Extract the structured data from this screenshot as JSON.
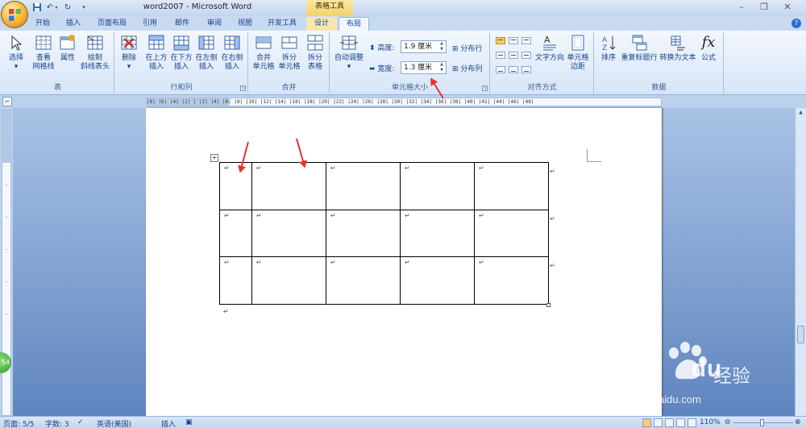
{
  "window": {
    "title": "word2007 - Microsoft Word",
    "context_tab_title": "表格工具",
    "controls": {
      "minimize": "–",
      "restore": "❐",
      "close": "✕"
    }
  },
  "tabs": [
    {
      "label": "开始"
    },
    {
      "label": "插入"
    },
    {
      "label": "页面布局"
    },
    {
      "label": "引用"
    },
    {
      "label": "邮件"
    },
    {
      "label": "审阅"
    },
    {
      "label": "视图"
    },
    {
      "label": "开发工具"
    },
    {
      "label": "设计"
    },
    {
      "label": "布局",
      "active": true
    }
  ],
  "ribbon": {
    "table": {
      "label": "表",
      "select": "选择",
      "gridlines_1": "查看",
      "gridlines_2": "网格线",
      "properties": "属性",
      "diag_1": "绘制",
      "diag_2": "斜线表头"
    },
    "rows_cols": {
      "label": "行和列",
      "delete": "删除",
      "above_1": "在上方",
      "above_2": "插入",
      "below_1": "在下方",
      "below_2": "插入",
      "left_1": "在左侧",
      "left_2": "插入",
      "right_1": "在右侧",
      "right_2": "插入"
    },
    "merge": {
      "label": "合并",
      "merge_1": "合并",
      "merge_2": "单元格",
      "split_1": "拆分",
      "split_2": "单元格",
      "splittable_1": "拆分",
      "splittable_2": "表格"
    },
    "cell_size": {
      "label": "单元格大小",
      "autofit": "自动调整",
      "height_label": "高度:",
      "height_value": "1.9 厘米",
      "width_label": "宽度:",
      "width_value": "1.3 厘米",
      "dist_rows": "分布行",
      "dist_cols": "分布列"
    },
    "alignment": {
      "label": "对齐方式",
      "text_dir": "文字方向",
      "margins_1": "单元格",
      "margins_2": "边距"
    },
    "data": {
      "label": "数据",
      "sort": "排序",
      "repeat_header": "重复标题行",
      "to_text": "转换为文本",
      "formula": "公式",
      "formula_glyph": "fx"
    }
  },
  "document": {
    "para_mark": "↵",
    "table_handle": "+",
    "ruler_top": "|8| |6| |4| |2| | |2| |4| |6| |8| |10| |12| |14| |16| |18| |20| |22| |24| |26| |28| |30| |32| |34| |36| |38| |40| |42| |44| |46| |48|",
    "rows": [
      [
        "↵",
        "↵",
        "↵",
        "↵",
        "↵"
      ],
      [
        "↵",
        "↵",
        "↵",
        "↵",
        "↵"
      ],
      [
        "↵",
        "↵",
        "↵",
        "↵",
        "↵"
      ]
    ]
  },
  "badge": "54",
  "watermark": {
    "brand": "Bai",
    "brand_tail": "du",
    "cn": "经验",
    "url": "jingyan.baidu.com"
  },
  "status": {
    "page": "页面: 5/5",
    "words": "字数: 3",
    "language": "英语(美国)",
    "mode": "插入",
    "zoom": "110%"
  }
}
